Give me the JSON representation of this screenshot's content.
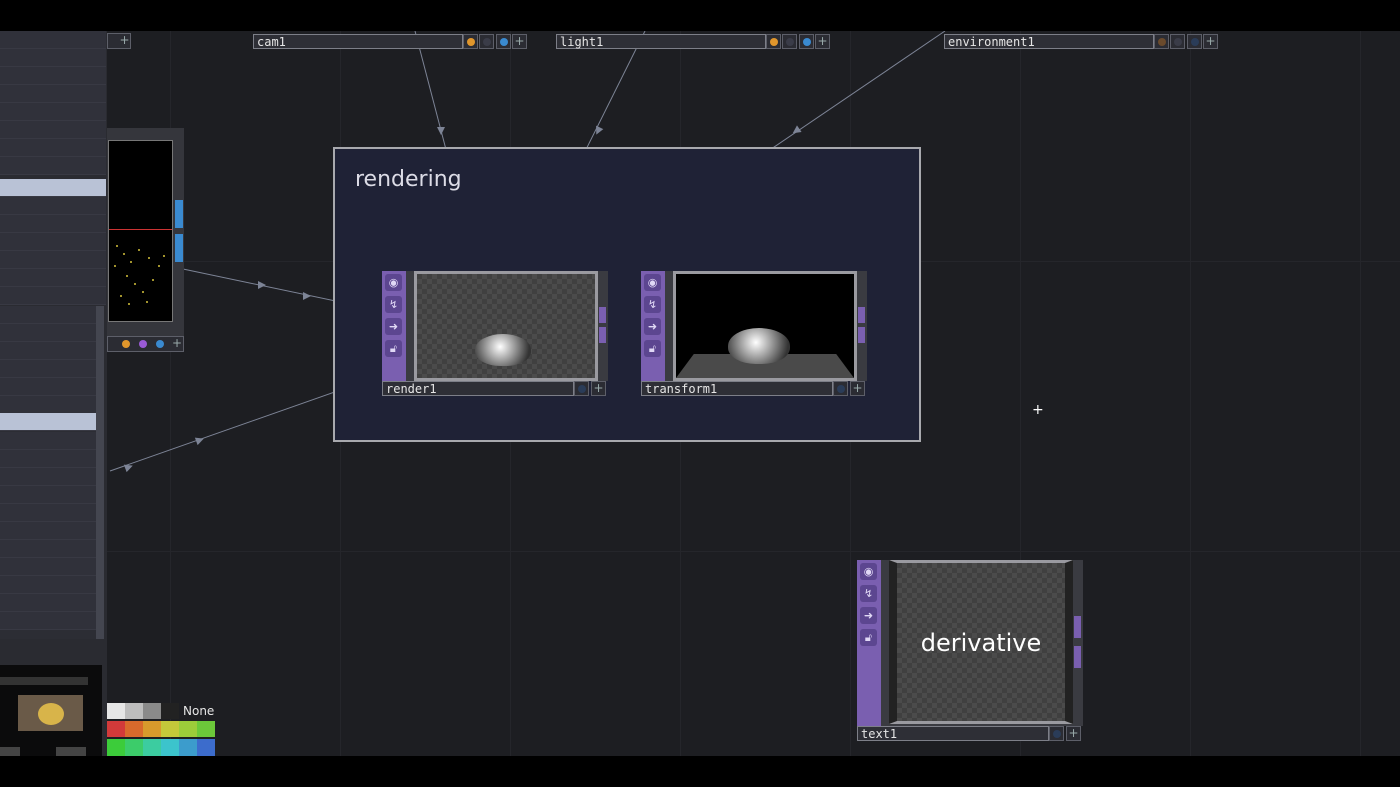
{
  "network": {
    "annotation_title": "rendering",
    "nodes": {
      "cam1": "cam1",
      "light1": "light1",
      "environment1": "environment1",
      "render1": "render1",
      "transform1": "transform1",
      "text1": "text1",
      "text1_content": "derivative"
    }
  },
  "palette": {
    "none_label": "None",
    "row1": [
      "#e6e6e6",
      "#bdbdbd",
      "#8a8a8a",
      "#222222"
    ],
    "row2": [
      "#d23a3a",
      "#d86a2c",
      "#d89a2c",
      "#c4c83a",
      "#9ccc3a",
      "#6cc83a"
    ],
    "row3": [
      "#3ccc3a",
      "#3ccc6a",
      "#3ccca0",
      "#3cc4cc",
      "#3c9ccc",
      "#3c6ccc"
    ]
  },
  "colors": {
    "background": "#1d1e22",
    "annotation_fill": "#1f2236",
    "node_sidebar": "#7a5fb0",
    "wire": "#7d8496"
  },
  "icons": [
    "viewer-icon",
    "activity-icon",
    "arrow-right-icon",
    "lock-icon",
    "plus-icon"
  ]
}
